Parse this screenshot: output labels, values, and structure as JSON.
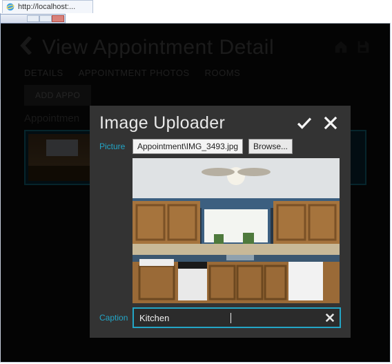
{
  "browser": {
    "url": "http://localhost:..."
  },
  "page": {
    "title": "View Appointment Detail",
    "tabs": {
      "details": "DETAILS",
      "photos": "APPOINTMENT PHOTOS",
      "rooms": "ROOMS"
    },
    "addButton": "ADD APPO",
    "subheading": "Appointmen"
  },
  "modal": {
    "title": "Image Uploader",
    "pictureLabel": "Picture",
    "picturePath": "Appointment\\IMG_3493.jpg",
    "browseLabel": "Browse...",
    "captionLabel": "Caption",
    "captionValue": "Kitchen",
    "colors": {
      "accent": "#23a6c7",
      "panel": "#333333"
    }
  }
}
